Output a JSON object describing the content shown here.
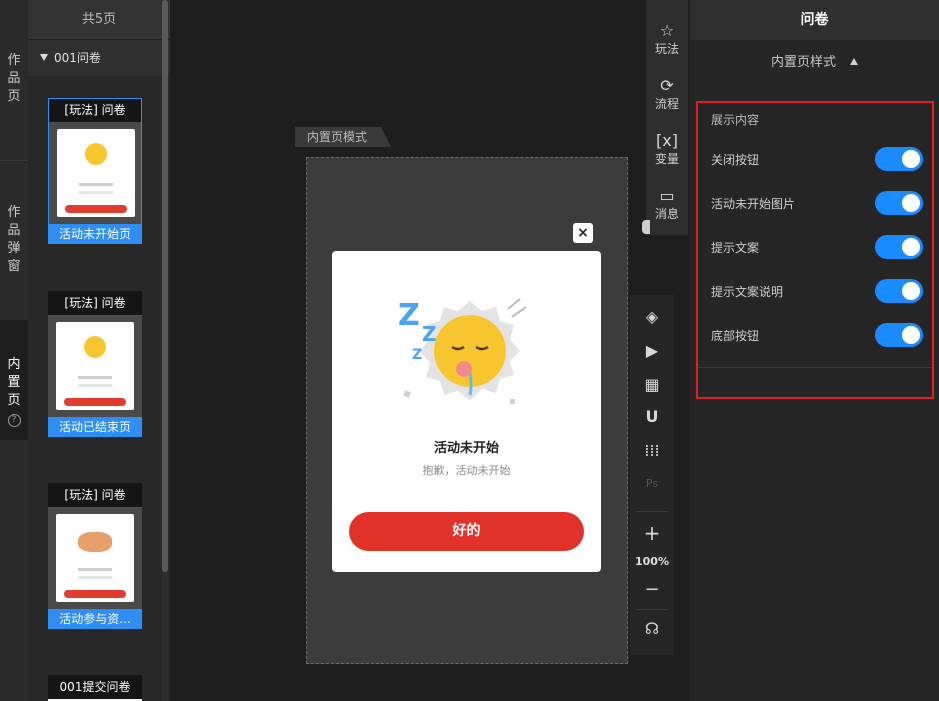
{
  "left_nav": {
    "items": [
      {
        "label": "作品页"
      },
      {
        "label": "作品弹窗"
      },
      {
        "label": "内置页"
      }
    ],
    "help_glyph": "?"
  },
  "page_list": {
    "header": "共5页",
    "group": "001问卷",
    "thumbs": [
      {
        "title": "[玩法] 问卷",
        "label": "活动未开始页"
      },
      {
        "title": "[玩法] 问卷",
        "label": "活动已结束页"
      },
      {
        "title": "[玩法] 问卷",
        "label": "活动参与资..."
      },
      {
        "title": "001提交问卷",
        "label": ""
      }
    ]
  },
  "canvas": {
    "mode_tab": "内置页模式",
    "close_glyph": "×",
    "modal": {
      "title": "活动未开始",
      "subtitle": "抱歉，活动未开始",
      "button": "好的"
    }
  },
  "tools": {
    "top": [
      {
        "label": "玩法",
        "icon": "gameplay-icon"
      },
      {
        "label": "流程",
        "icon": "flow-icon"
      },
      {
        "label": "变量",
        "icon": "variable-icon"
      },
      {
        "label": "消息",
        "icon": "message-icon"
      }
    ],
    "zoom": "100%"
  },
  "props": {
    "title": "问卷",
    "subtitle": "内置页样式",
    "section_title": "展示内容",
    "rows": [
      {
        "label": "关闭按钮",
        "on": true
      },
      {
        "label": "活动未开始图片",
        "on": true
      },
      {
        "label": "提示文案",
        "on": true
      },
      {
        "label": "提示文案说明",
        "on": true
      },
      {
        "label": "底部按钮",
        "on": true
      }
    ]
  },
  "colors": {
    "accent_blue": "#1a8cff",
    "button_red": "#e1322a",
    "highlight_border": "#e02020"
  }
}
